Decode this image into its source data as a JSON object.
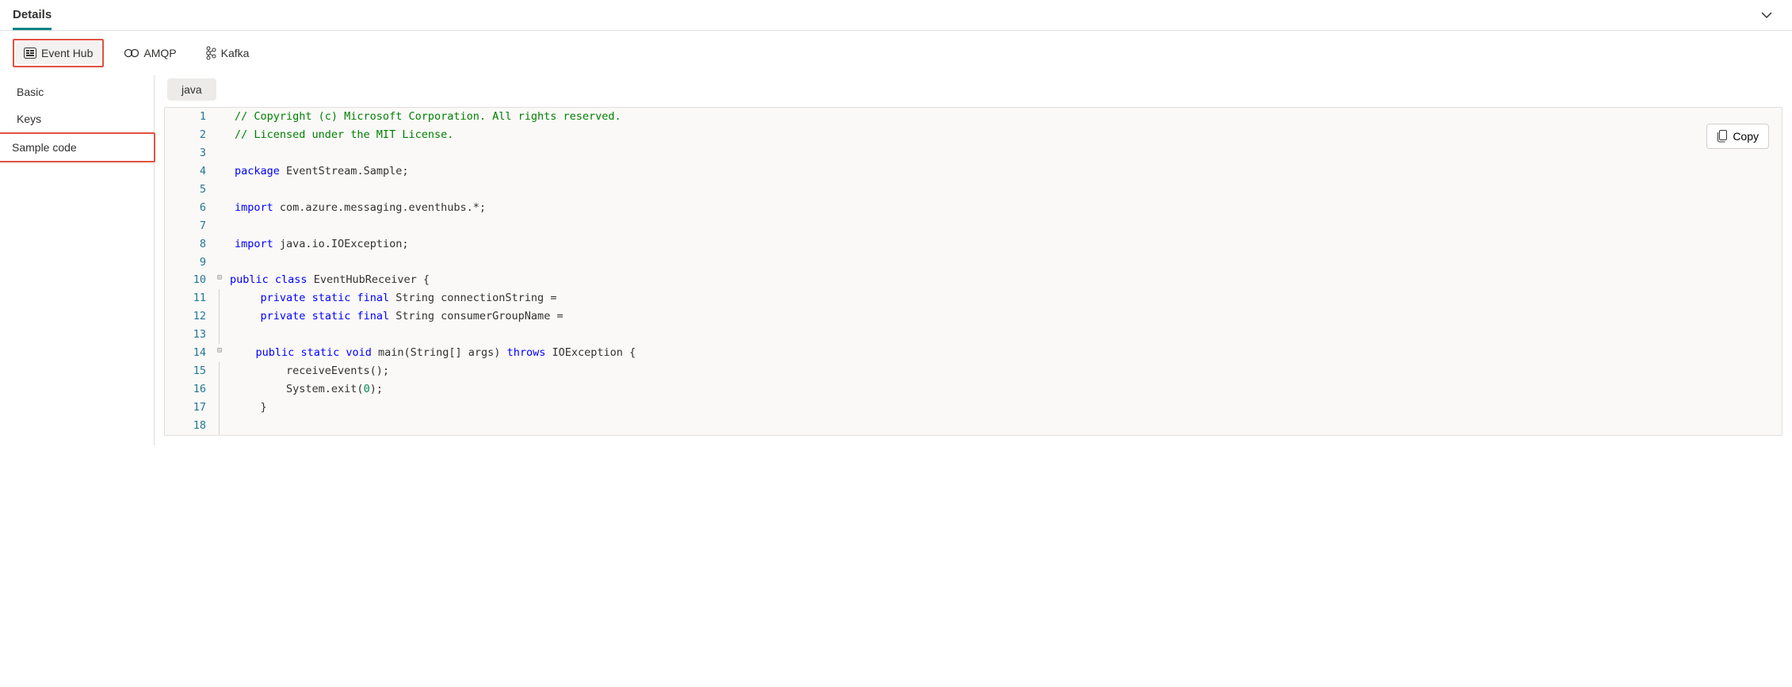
{
  "header": {
    "tab_label": "Details"
  },
  "protocols": {
    "event_hub": "Event Hub",
    "amqp": "AMQP",
    "kafka": "Kafka"
  },
  "sidebar": {
    "basic": "Basic",
    "keys": "Keys",
    "sample_code": "Sample code"
  },
  "main": {
    "language": "java",
    "copy_label": "Copy"
  },
  "code": {
    "l1": "// Copyright (c) Microsoft Corporation. All rights reserved.",
    "l2": "// Licensed under the MIT License.",
    "l3": "",
    "l4_a": "package",
    "l4_b": " EventStream.Sample;",
    "l5": "",
    "l6_a": "import",
    "l6_b": " com.azure.messaging.eventhubs.*;",
    "l7": "",
    "l8_a": "import",
    "l8_b": " java.io.IOException;",
    "l9": "",
    "l10_a": "public",
    "l10_b": "class",
    "l10_c": " EventHubReceiver {",
    "l11_a": "private",
    "l11_b": "static",
    "l11_c": "final",
    "l11_d": " String connectionString =",
    "l12_a": "private",
    "l12_b": "static",
    "l12_c": "final",
    "l12_d": " String consumerGroupName =",
    "l13": "",
    "l14_a": "public",
    "l14_b": "static",
    "l14_c": "void",
    "l14_d": " main(String[] args) ",
    "l14_e": "throws",
    "l14_f": " IOException {",
    "l15": "        receiveEvents();",
    "l16_a": "        System.exit(",
    "l16_b": "0",
    "l16_c": ");",
    "l17": "    }",
    "l18": ""
  }
}
